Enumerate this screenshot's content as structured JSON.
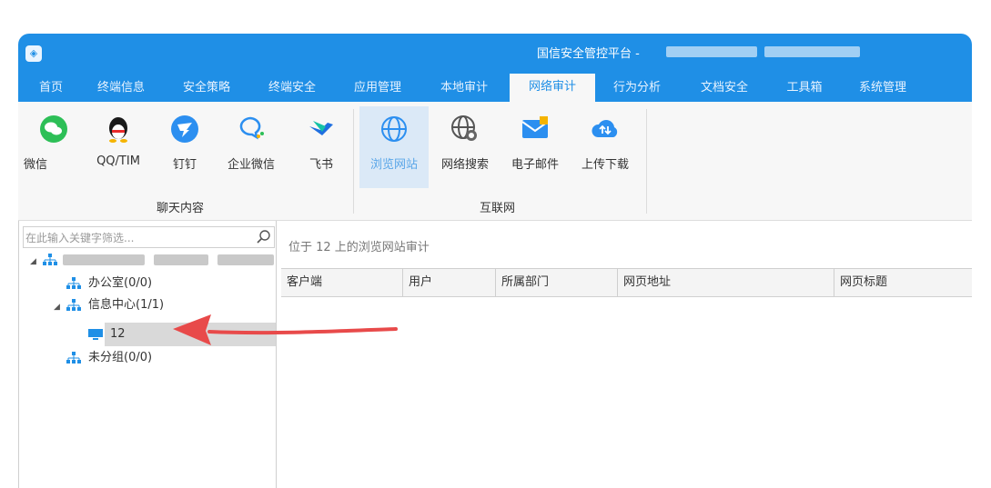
{
  "window": {
    "title": "国信安全管控平台 -"
  },
  "menu": {
    "items": [
      {
        "label": "首页"
      },
      {
        "label": "终端信息"
      },
      {
        "label": "安全策略"
      },
      {
        "label": "终端安全"
      },
      {
        "label": "应用管理"
      },
      {
        "label": "本地审计"
      },
      {
        "label": "网络审计",
        "active": true
      },
      {
        "label": "行为分析"
      },
      {
        "label": "文档安全"
      },
      {
        "label": "工具箱"
      },
      {
        "label": "系统管理"
      }
    ]
  },
  "ribbon": {
    "chat_group": {
      "label": "聊天内容",
      "buttons": [
        {
          "label": "微信",
          "icon": "wechat-icon"
        },
        {
          "label": "QQ/TIM",
          "icon": "qq-icon"
        },
        {
          "label": "钉钉",
          "icon": "dingtalk-icon"
        },
        {
          "label": "企业微信",
          "icon": "wecom-icon"
        },
        {
          "label": "飞书",
          "icon": "feishu-icon"
        }
      ]
    },
    "internet_group": {
      "label": "互联网",
      "buttons": [
        {
          "label": "浏览网站",
          "icon": "globe-icon",
          "active": true
        },
        {
          "label": "网络搜索",
          "icon": "globe-search-icon"
        },
        {
          "label": "电子邮件",
          "icon": "mail-icon"
        },
        {
          "label": "上传下载",
          "icon": "cloud-upload-icon"
        }
      ]
    }
  },
  "sidebar": {
    "search_placeholder": "在此输入关键字筛选...",
    "tree": [
      {
        "label": "办公室(0/0)"
      },
      {
        "label": "信息中心(1/1)"
      },
      {
        "label": "12"
      },
      {
        "label": "未分组(0/0)"
      }
    ]
  },
  "main": {
    "breadcrumb": "位于 12 上的浏览网站审计",
    "columns": [
      "客户端",
      "用户",
      "所属部门",
      "网页地址",
      "网页标题"
    ]
  },
  "colors": {
    "accent": "#1f8fe6",
    "annotation_arrow": "#e84a4a"
  }
}
